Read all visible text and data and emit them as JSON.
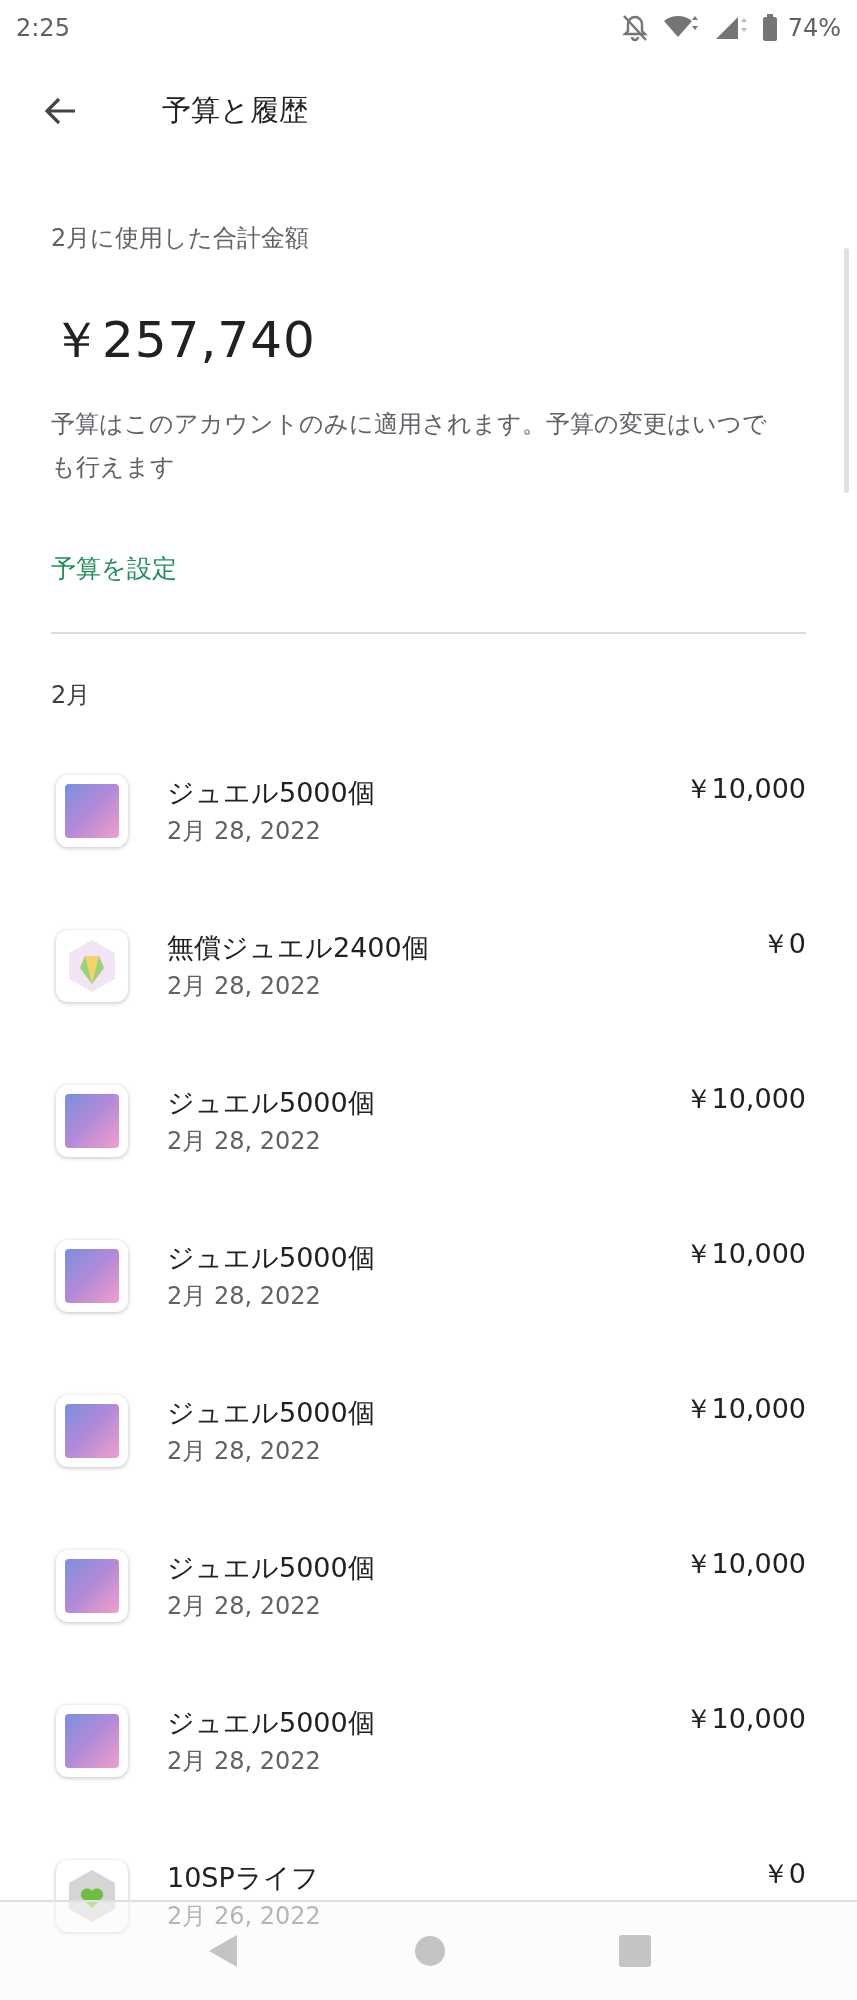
{
  "status_bar": {
    "time": "2:25",
    "battery": "74%"
  },
  "app_bar": {
    "title": "予算と履歴"
  },
  "summary": {
    "label": "2月に使用した合計金額",
    "amount": "￥257,740",
    "description": "予算はこのアカウントのみに適用されます。予算の変更はいつでも行えます",
    "link": "予算を設定"
  },
  "month": "2月",
  "purchases": [
    {
      "kind": "character",
      "title": "ジュエル5000個",
      "date": "2月 28, 2022",
      "price": "￥10,000"
    },
    {
      "kind": "jewel",
      "title": "無償ジュエル2400個",
      "date": "2月 28, 2022",
      "price": "￥0"
    },
    {
      "kind": "character",
      "title": "ジュエル5000個",
      "date": "2月 28, 2022",
      "price": "￥10,000"
    },
    {
      "kind": "character",
      "title": "ジュエル5000個",
      "date": "2月 28, 2022",
      "price": "￥10,000"
    },
    {
      "kind": "character",
      "title": "ジュエル5000個",
      "date": "2月 28, 2022",
      "price": "￥10,000"
    },
    {
      "kind": "character",
      "title": "ジュエル5000個",
      "date": "2月 28, 2022",
      "price": "￥10,000"
    },
    {
      "kind": "character",
      "title": "ジュエル5000個",
      "date": "2月 28, 2022",
      "price": "￥10,000"
    },
    {
      "kind": "heart",
      "title": "10SPライフ",
      "date": "2月 26, 2022",
      "price": "￥0"
    }
  ]
}
